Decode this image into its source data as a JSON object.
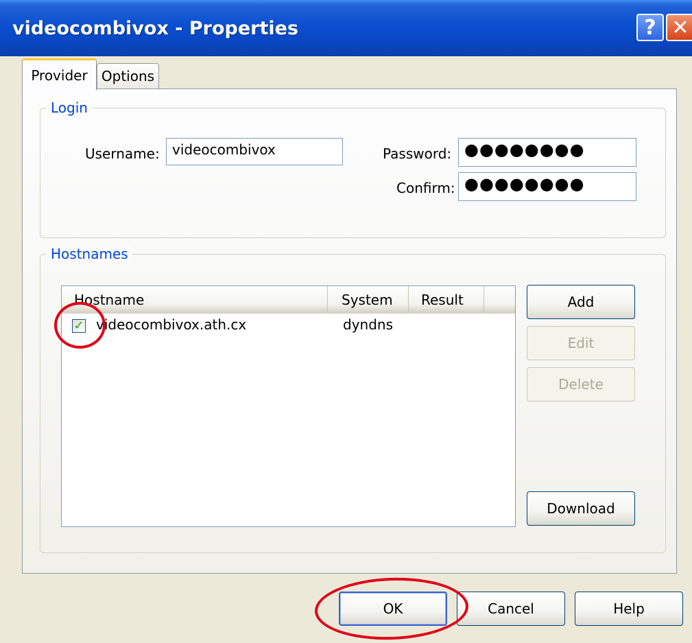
{
  "window": {
    "title": "videocombivox - Properties",
    "help_glyph": "?",
    "close_glyph": "✕"
  },
  "tabs": [
    {
      "label": "Provider",
      "active": true
    },
    {
      "label": "Options",
      "active": false
    }
  ],
  "login": {
    "legend": "Login",
    "username_label": "Username:",
    "username_value": "videocombivox",
    "password_label": "Password:",
    "password_value": "●●●●●●●●",
    "confirm_label": "Confirm:",
    "confirm_value": "●●●●●●●●"
  },
  "hostnames": {
    "legend": "Hostnames",
    "columns": [
      "Hostname",
      "System",
      "Result"
    ],
    "rows": [
      {
        "checked": true,
        "check_glyph": "✓",
        "hostname": "videocombivox.ath.cx",
        "system": "dyndns",
        "result": ""
      }
    ],
    "buttons": {
      "add": "Add",
      "edit": "Edit",
      "delete": "Delete",
      "download": "Download"
    }
  },
  "footer": {
    "ok": "OK",
    "cancel": "Cancel",
    "help": "Help"
  },
  "colors": {
    "title_bar": "#0a4fd0",
    "group_legend": "#0046d5",
    "annotation": "#e00018"
  }
}
